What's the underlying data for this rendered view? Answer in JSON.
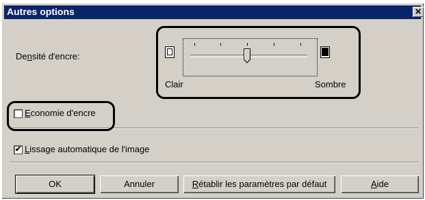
{
  "window": {
    "title": "Autres options",
    "close_glyph": "✕"
  },
  "density": {
    "label_pre": "De",
    "label_u": "n",
    "label_post": "sité d'encre:",
    "min_label": "Clair",
    "max_label": "Sombre",
    "value_fraction": 0.5
  },
  "economy": {
    "u": "E",
    "rest": "conomie d'encre",
    "checked": false
  },
  "smoothing": {
    "u": "L",
    "rest": "issage automatique de l'image",
    "checked": true,
    "check_glyph": "✔"
  },
  "buttons": {
    "ok": "OK",
    "cancel": "Annuler",
    "reset_u": "R",
    "reset_rest": "établir les paramètres par défaut",
    "help_u": "A",
    "help_rest": "ide"
  }
}
